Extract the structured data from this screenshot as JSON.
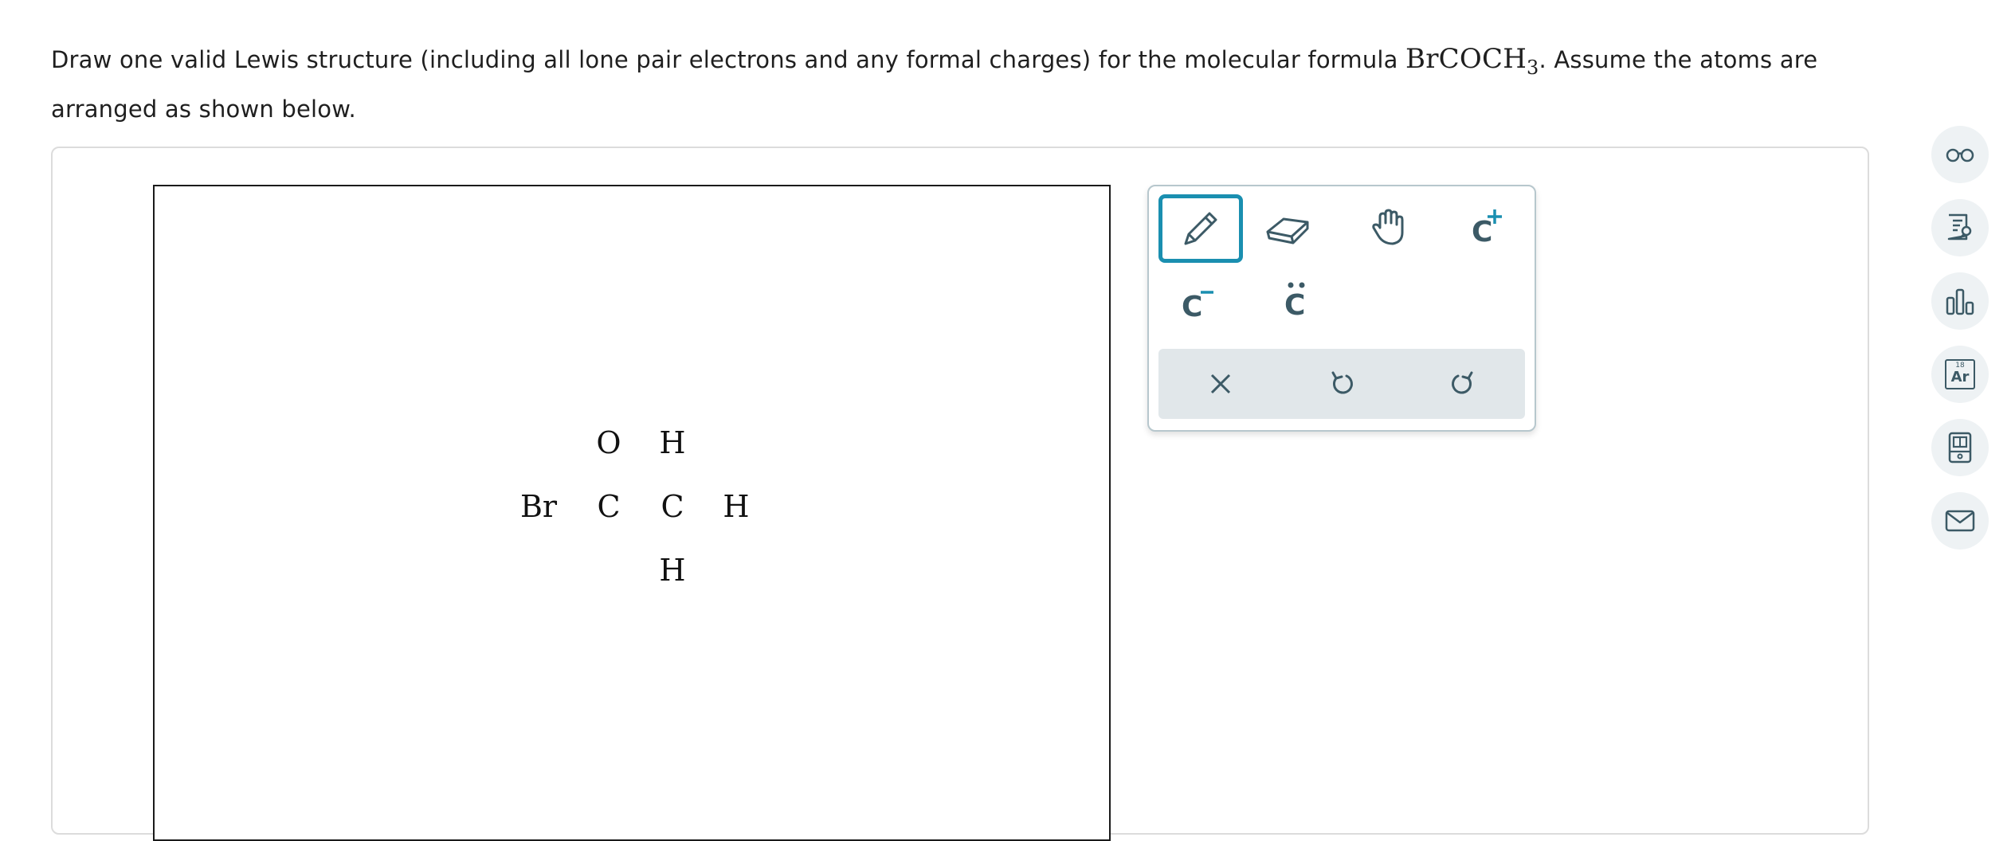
{
  "question": {
    "text_before": "Draw one valid Lewis structure (including all lone pair electrons and any formal charges) for the molecular formula ",
    "formula_main": "BrCOCH",
    "formula_sub": "3",
    "text_after": ". Assume the atoms are arranged as shown below."
  },
  "atoms": [
    {
      "label": "O",
      "name": "atom-o"
    },
    {
      "label": "H",
      "name": "atom-h-top"
    },
    {
      "label": "Br",
      "name": "atom-br"
    },
    {
      "label": "C",
      "name": "atom-c-carbonyl"
    },
    {
      "label": "C",
      "name": "atom-c-methyl"
    },
    {
      "label": "H",
      "name": "atom-h-right"
    },
    {
      "label": "H",
      "name": "atom-h-bottom"
    }
  ],
  "palette": {
    "tools": [
      {
        "name": "pencil-tool",
        "icon": "pencil-icon",
        "selected": true
      },
      {
        "name": "eraser-tool",
        "icon": "eraser-icon",
        "selected": false
      },
      {
        "name": "pan-hand-tool",
        "icon": "hand-icon",
        "selected": false
      },
      {
        "name": "positive-charge-tool",
        "icon": "positive-charge-icon",
        "label": "C",
        "selected": false
      },
      {
        "name": "negative-charge-tool",
        "icon": "negative-charge-icon",
        "label": "C",
        "selected": false
      },
      {
        "name": "lone-pair-tool",
        "icon": "lone-pair-icon",
        "label": "C",
        "selected": false
      }
    ],
    "actions": [
      {
        "name": "clear-button",
        "icon": "close-icon"
      },
      {
        "name": "undo-button",
        "icon": "undo-icon"
      },
      {
        "name": "redo-button",
        "icon": "redo-icon"
      }
    ]
  },
  "sidebar": [
    {
      "name": "accessibility-button",
      "icon": "glasses-icon"
    },
    {
      "name": "exploration-button",
      "icon": "document-search-icon"
    },
    {
      "name": "data-button",
      "icon": "bar-chart-icon"
    },
    {
      "name": "periodic-table-button",
      "icon": "periodic-table-icon",
      "element_number": "18",
      "element_symbol": "Ar"
    },
    {
      "name": "calculator-button",
      "icon": "calculator-icon"
    },
    {
      "name": "message-button",
      "icon": "mail-icon"
    }
  ],
  "colors": {
    "accent": "#1a8fb0",
    "icon": "#3c5a66",
    "action_bar": "#e1e7ea",
    "side_button": "#eef2f4"
  }
}
